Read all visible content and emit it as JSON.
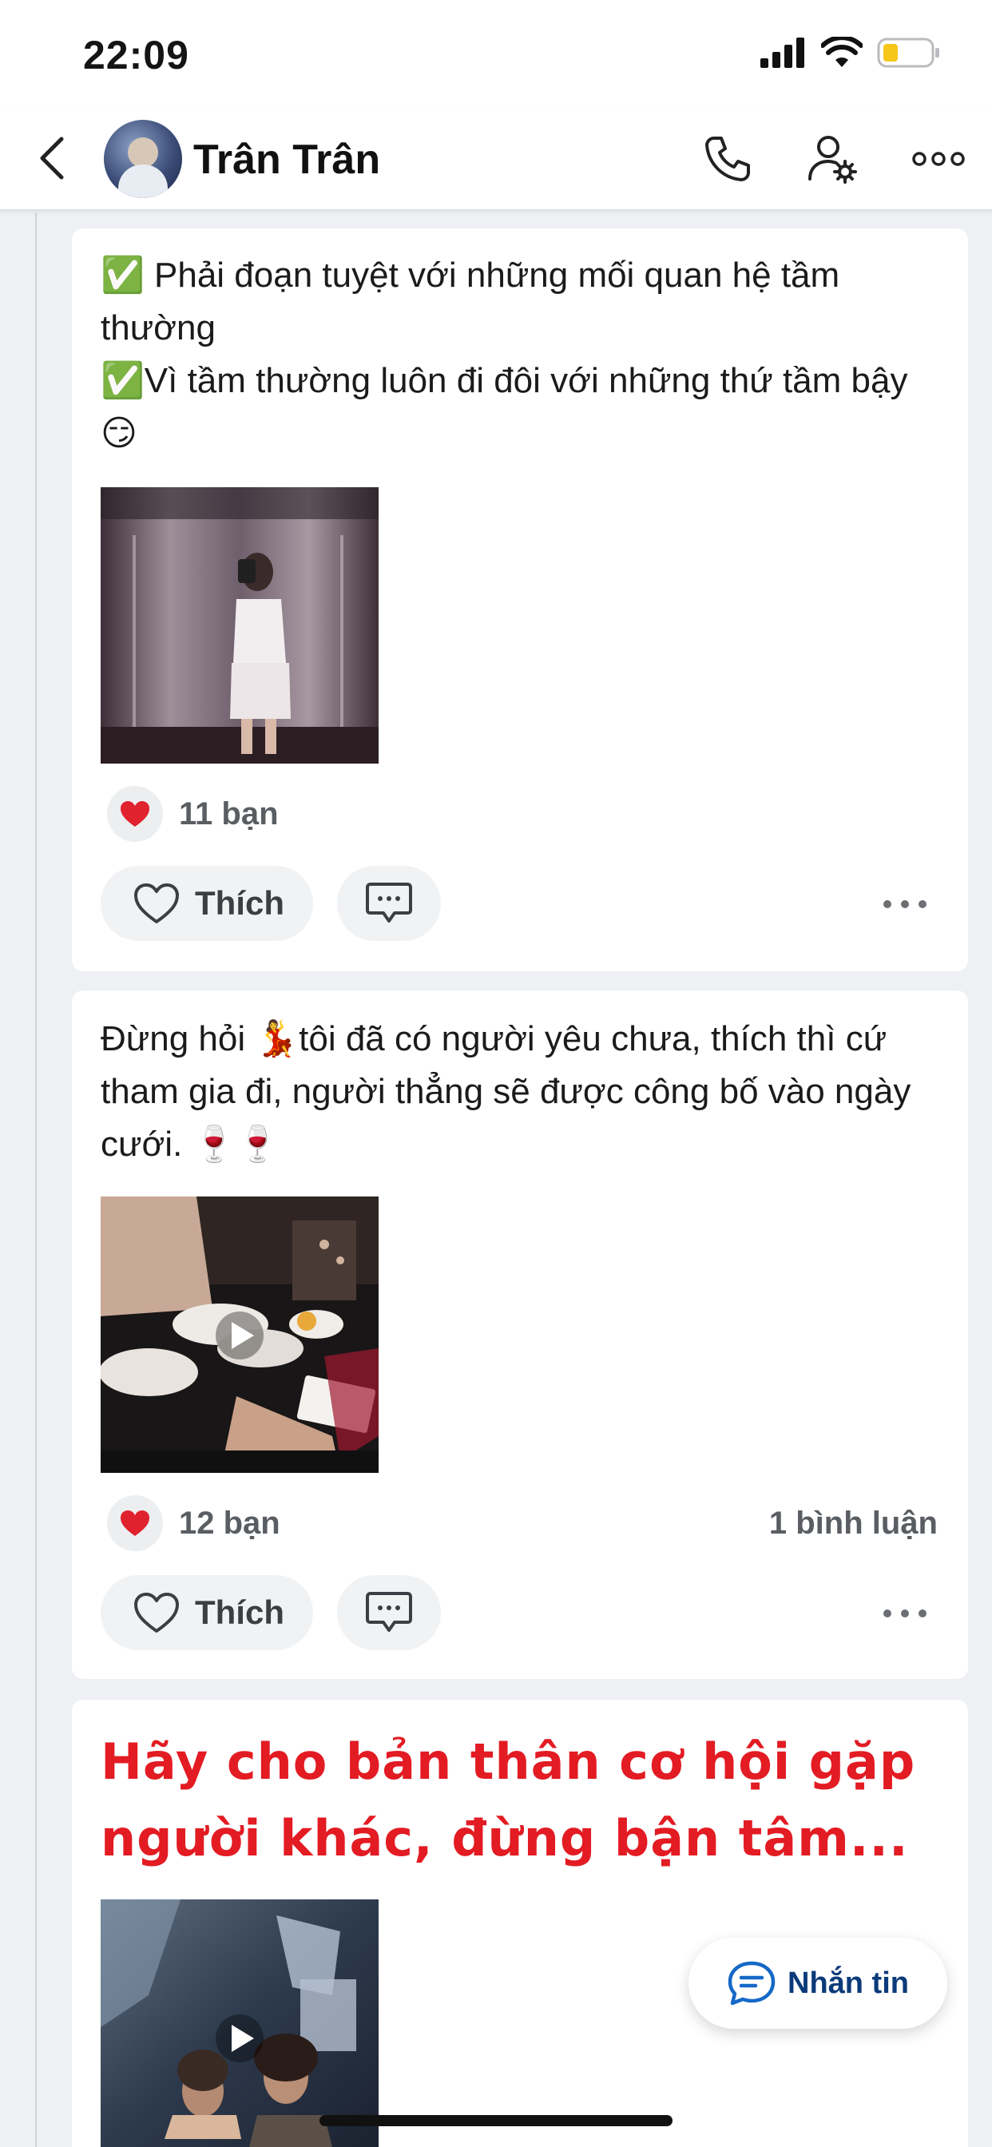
{
  "status_bar": {
    "time": "22:09"
  },
  "header": {
    "contact_name": "Trân Trân"
  },
  "posts": [
    {
      "lines": [
        "✅ Phải đoạn tuyệt với những mối quan hệ tầm thường",
        "✅Vì tầm thường luôn đi đôi với những thứ tầm bậy 😏"
      ],
      "media": "photo",
      "reaction_count": "11 bạn",
      "comment_count": "",
      "like_label": "Thích"
    },
    {
      "lines": [
        "Đừng hỏi 💃tôi đã có người yêu chưa, thích thì cứ tham gia đi, người thẳng sẽ được công bố vào ngày cưới. 🍷🍷"
      ],
      "media": "video",
      "reaction_count": "12 bạn",
      "comment_count": "1 bình luận",
      "like_label": "Thích"
    },
    {
      "headline": "Hãy cho bản thân cơ hội gặp người khác, đừng bận tâm...",
      "media": "video"
    }
  ],
  "message_button": {
    "label": "Nhắn tin"
  },
  "colors": {
    "accent_blue": "#0b3a7a",
    "headline_red": "#e31b23",
    "heart_red": "#e0212e"
  },
  "icons": [
    "back-chevron-icon",
    "phone-icon",
    "user-settings-icon",
    "more-dots-icon",
    "heart-icon",
    "comment-icon",
    "play-icon",
    "chat-bubble-icon"
  ]
}
